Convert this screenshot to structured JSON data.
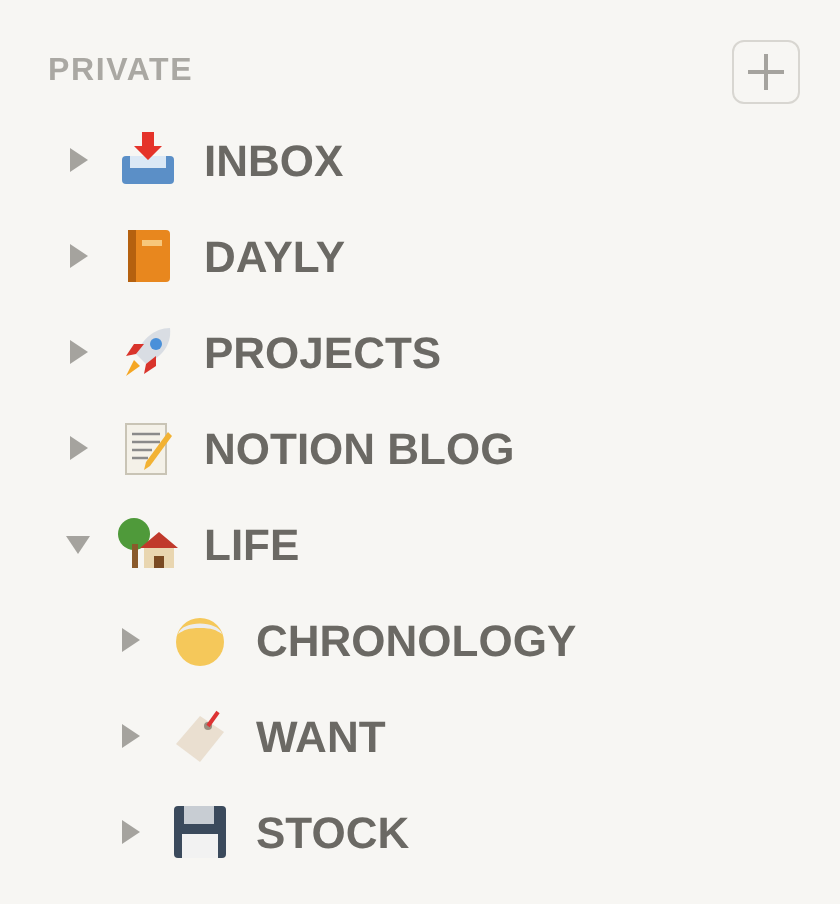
{
  "section": {
    "title": "PRIVATE"
  },
  "items": [
    {
      "label": "INBOX",
      "expanded": false
    },
    {
      "label": "DAYLY",
      "expanded": false
    },
    {
      "label": "PROJECTS",
      "expanded": false
    },
    {
      "label": "NOTION BLOG",
      "expanded": false
    },
    {
      "label": "LIFE",
      "expanded": true,
      "children": [
        {
          "label": "CHRONOLOGY",
          "expanded": false
        },
        {
          "label": "WANT",
          "expanded": false
        },
        {
          "label": "STOCK",
          "expanded": false
        }
      ]
    }
  ]
}
